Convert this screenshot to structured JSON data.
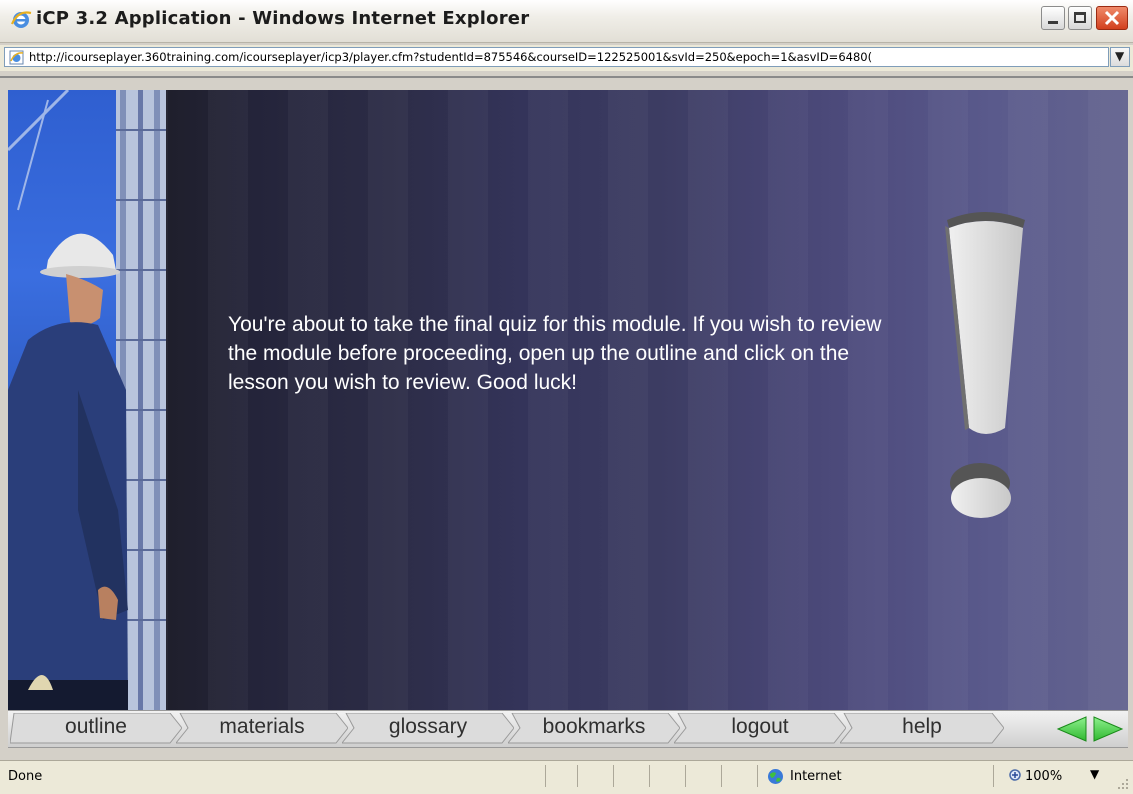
{
  "window": {
    "title": "iCP 3.2 Application - Windows Internet Explorer",
    "buttons": [
      "minimize",
      "maximize",
      "close"
    ]
  },
  "address_bar": {
    "url": "http://icourseplayer.360training.com/icourseplayer/icp3/player.cfm?studentId=875546&courseID=122525001&svId=250&epoch=1&asvID=6480("
  },
  "content": {
    "message": "You're about to take the final quiz for this module. If you wish to review the module before proceeding, open up the outline and click on the lesson you wish to review. Good luck!"
  },
  "nav": {
    "tabs": [
      {
        "label": "outline"
      },
      {
        "label": "materials"
      },
      {
        "label": "glossary"
      },
      {
        "label": "bookmarks"
      },
      {
        "label": "logout"
      },
      {
        "label": "help"
      }
    ],
    "arrows": [
      "previous",
      "next"
    ],
    "arrow_color": "#3fcf3f"
  },
  "status_bar": {
    "status": "Done",
    "zone": "Internet",
    "zoom": "100%"
  },
  "colors": {
    "close_button": "#d2401e",
    "content_dark": "#141418",
    "content_light": "#64648f",
    "exclamation": "#e2e2e2"
  }
}
